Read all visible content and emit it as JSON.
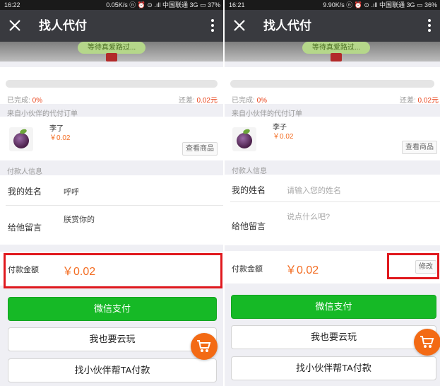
{
  "left": {
    "status": {
      "time": "16:22",
      "network": "0.05K/s ⓝ ⏰ ⊙ .ıll 中国联通 3G ▭ 37%"
    },
    "title": "找人代付",
    "banner_text": "等待真爱路过...",
    "progress": {
      "fraction": 0,
      "completed_label": "已完成:",
      "completed_value": "0%",
      "remaining_label": "还差:",
      "remaining_value": "0.02元"
    },
    "order_section_label": "来自小伙伴的代付订单",
    "product": {
      "name": "李了",
      "price": "￥0.02",
      "view_button": "查看商品"
    },
    "payer_section_label": "付款人信息",
    "name_row": {
      "label": "我的姓名",
      "value": "呼呼"
    },
    "message_row": {
      "label": "给他留言",
      "value": "朕赏你的"
    },
    "amount": {
      "label": "付款金额",
      "value": "￥0.02"
    },
    "buttons": {
      "wechat_pay": "微信支付",
      "play_too": "我也要云玩",
      "find_friend": "找小伙伴帮TA付款"
    }
  },
  "right": {
    "status": {
      "time": "16:21",
      "network": "9.90K/s ⓝ ⏰ ⊙ .ıll 中国联通 3G ▭ 36%"
    },
    "title": "找人代付",
    "banner_text": "等待真爱路过...",
    "progress": {
      "fraction": 0,
      "completed_label": "已完成:",
      "completed_value": "0%",
      "remaining_label": "还差:",
      "remaining_value": "0.02元"
    },
    "order_section_label": "来自小伙伴的代付订单",
    "product": {
      "name": "李子",
      "price": "￥0.02",
      "view_button": "查看商品"
    },
    "payer_section_label": "付款人信息",
    "name_row": {
      "label": "我的姓名",
      "placeholder": "请输入您的姓名"
    },
    "message_row": {
      "label": "给他留言",
      "placeholder": "说点什么吧?"
    },
    "amount": {
      "label": "付款金额",
      "value": "￥0.02",
      "modify_button": "修改"
    },
    "buttons": {
      "wechat_pay": "微信支付",
      "play_too": "我也要云玩",
      "find_friend": "找小伙伴帮TA付款"
    }
  },
  "colors": {
    "accent_orange": "#f36c21",
    "pay_green": "#16b926",
    "highlight_red": "#e0191e",
    "titlebar": "#393a3f"
  },
  "icons": [
    "close-icon",
    "more-icon",
    "cart-icon"
  ]
}
